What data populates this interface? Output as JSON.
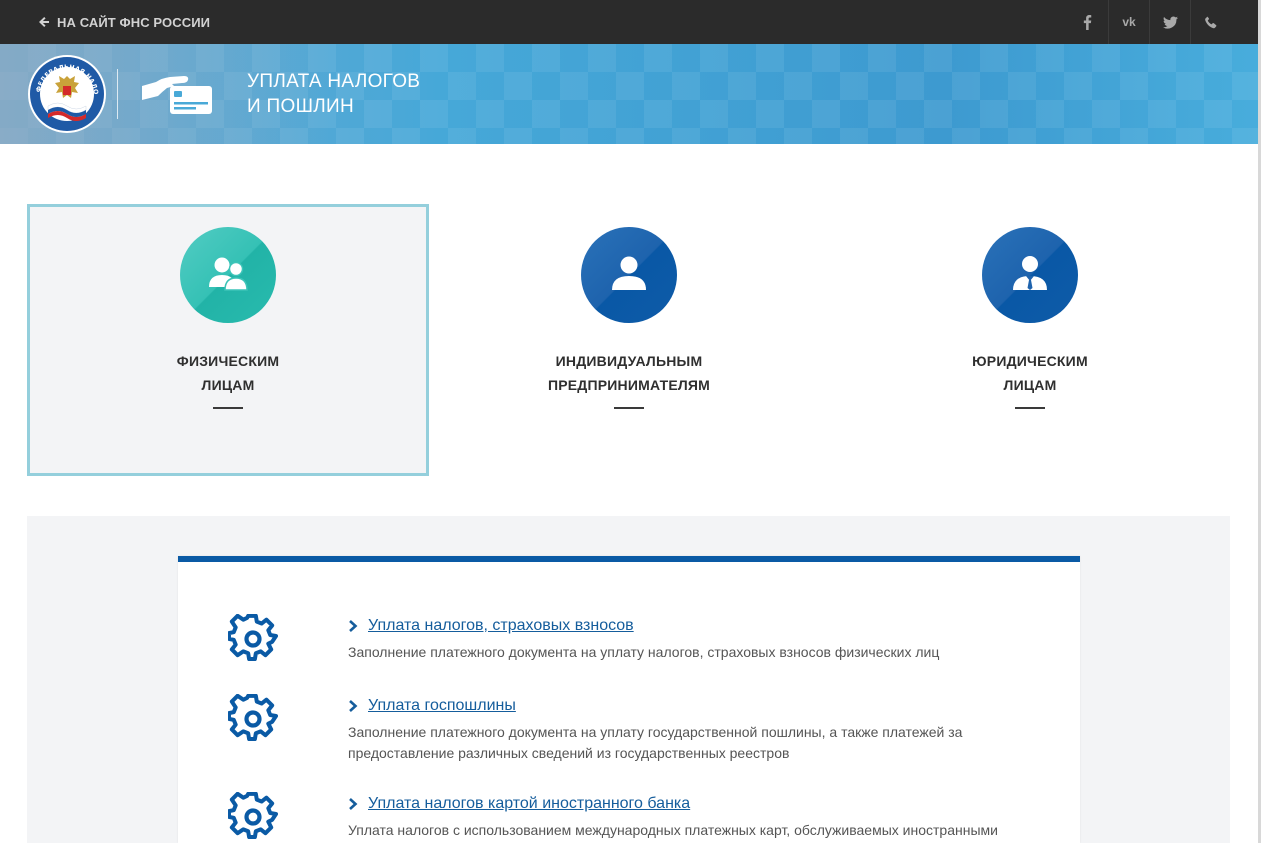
{
  "topbar": {
    "back_link": "НА САЙТ ФНС РОССИИ",
    "socials": [
      "facebook-icon",
      "vk-icon",
      "twitter-icon",
      "phone-icon"
    ],
    "vk_label": "vk"
  },
  "banner": {
    "emblem_text": "ФЕДЕРАЛЬНАЯ НАЛОГОВАЯ СЛУЖБА",
    "title_line1": "УПЛАТА НАЛОГОВ",
    "title_line2": "И ПОШЛИН"
  },
  "categories": [
    {
      "label": "ФИЗИЧЕСКИМ\nЛИЦАМ",
      "icon": "people-icon",
      "active": true
    },
    {
      "label": "ИНДИВИДУАЛЬНЫМ\nПРЕДПРИНИМАТЕЛЯМ",
      "icon": "person-icon",
      "active": false
    },
    {
      "label": "ЮРИДИЧЕСКИМ\nЛИЦАМ",
      "icon": "businessman-icon",
      "active": false
    }
  ],
  "services": [
    {
      "title": "Уплата налогов, страховых взносов",
      "description": "Заполнение платежного документа на уплату налогов, страховых взносов физических лиц"
    },
    {
      "title": "Уплата госпошлины",
      "description": "Заполнение платежного документа на уплату государственной пошлины, а также платежей за предоставление различных сведений из государственных реестров"
    },
    {
      "title": "Уплата налогов картой иностранного банка",
      "description": "Уплата налогов с использованием международных платежных карт, обслуживаемых иностранными"
    }
  ],
  "colors": {
    "topbar": "#2b2b2b",
    "accent_blue": "#0a5aa5",
    "teal": "#35c1b5",
    "link": "#155d9c",
    "active_border": "#94cfdc"
  }
}
